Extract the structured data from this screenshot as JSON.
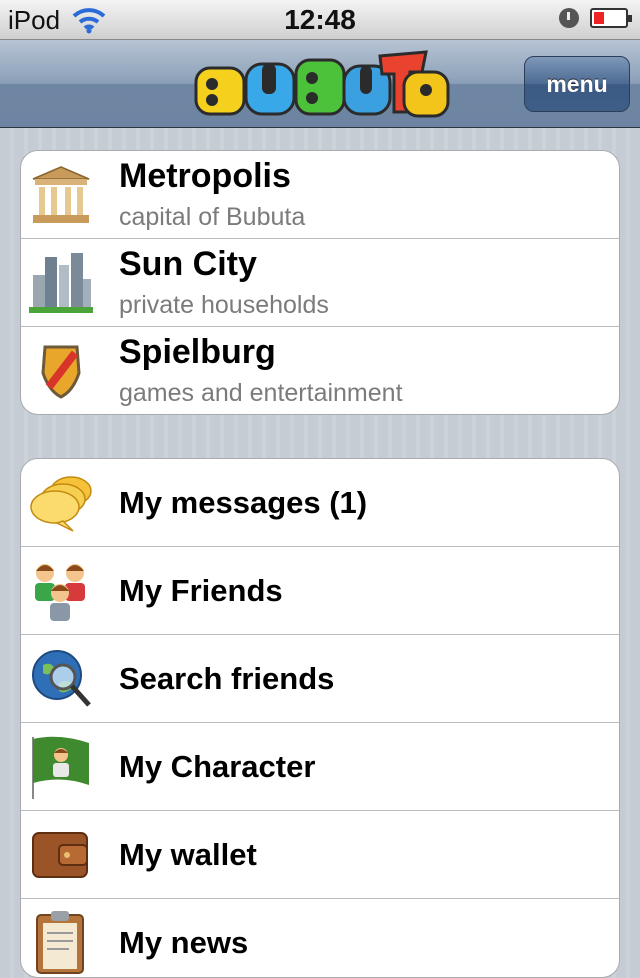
{
  "status_bar": {
    "carrier": "iPod",
    "time": "12:48"
  },
  "nav": {
    "logo_text": "BUBUTA",
    "menu_label": "menu"
  },
  "cities": [
    {
      "title": "Metropolis",
      "subtitle": "capital of Bubuta",
      "icon": "building-icon"
    },
    {
      "title": "Sun City",
      "subtitle": "private households",
      "icon": "skyscrapers-icon"
    },
    {
      "title": "Spielburg",
      "subtitle": "games and entertainment",
      "icon": "shield-icon"
    }
  ],
  "menu_items": [
    {
      "label": "My messages (1)",
      "icon": "speech-bubbles-icon"
    },
    {
      "label": "My Friends",
      "icon": "friends-icon"
    },
    {
      "label": "Search friends",
      "icon": "globe-search-icon"
    },
    {
      "label": "My Character",
      "icon": "flag-character-icon"
    },
    {
      "label": "My wallet",
      "icon": "wallet-icon"
    },
    {
      "label": "My news",
      "icon": "clipboard-icon"
    }
  ],
  "colors": {
    "nav_bar": "#6e86a3",
    "background": "#c5ccd4",
    "menu_button": "#3e5e88"
  }
}
